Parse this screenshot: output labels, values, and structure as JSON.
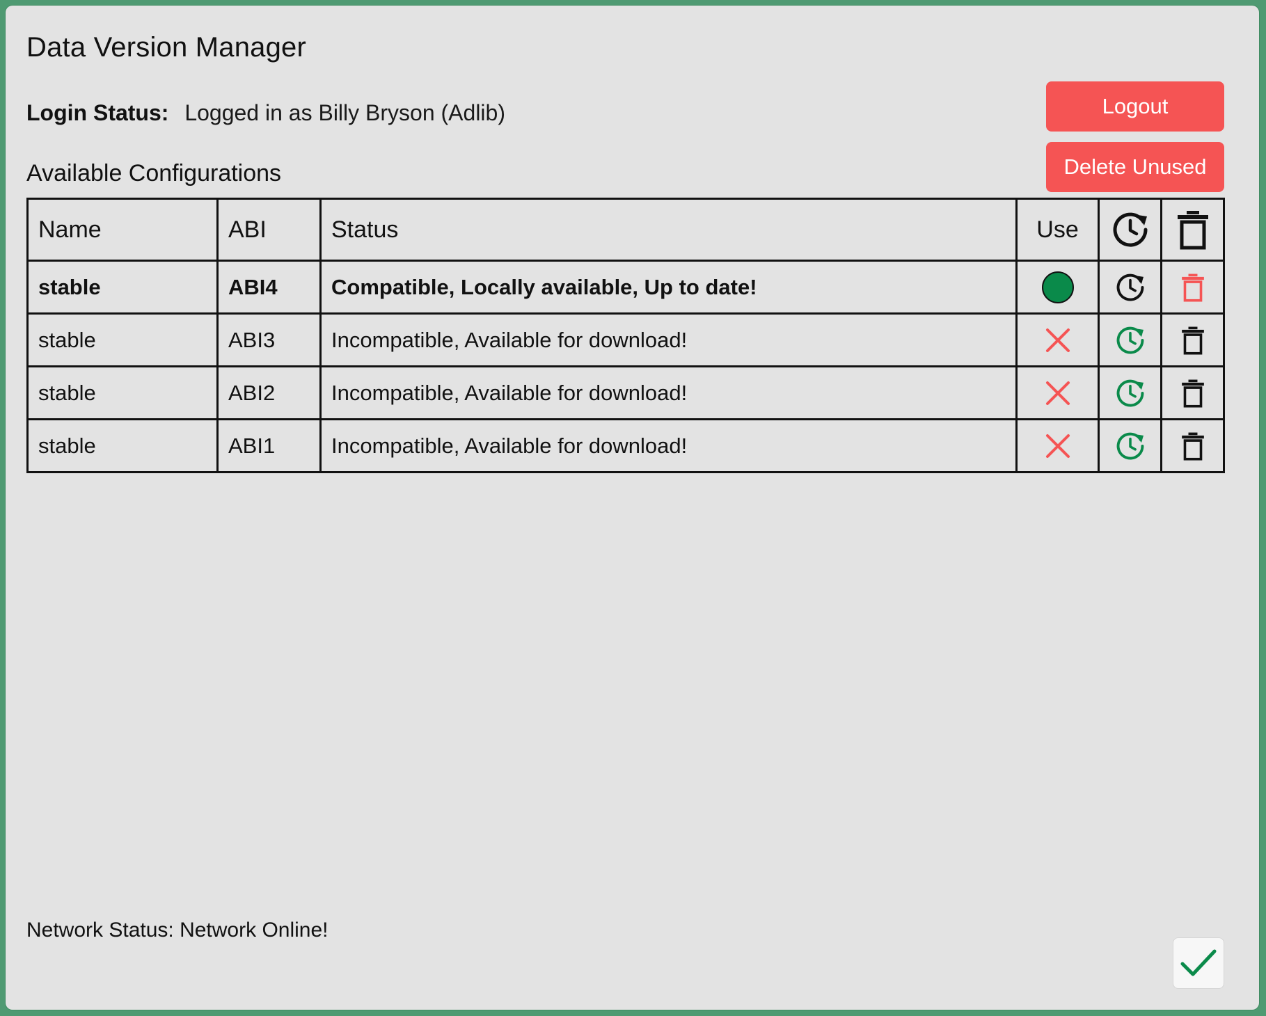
{
  "window": {
    "title": "Data Version Manager"
  },
  "login": {
    "label": "Login Status:",
    "value": "Logged in as Billy Bryson (Adlib)"
  },
  "buttons": {
    "logout": "Logout",
    "delete_unused": "Delete Unused"
  },
  "section_title": "Available Configurations",
  "table": {
    "headers": {
      "name": "Name",
      "abi": "ABI",
      "status": "Status",
      "use": "Use",
      "update_icon": "update-clock-icon",
      "delete_icon": "trash-icon"
    },
    "rows": [
      {
        "name": "stable",
        "abi": "ABI4",
        "status": "Compatible, Locally available, Up to date!",
        "use": "active-indicator",
        "update_color": "#111111",
        "delete_color": "#f55454",
        "active": true
      },
      {
        "name": "stable",
        "abi": "ABI3",
        "status": "Incompatible, Available for download!",
        "use": "incompatible-x",
        "update_color": "#0a8a4a",
        "delete_color": "#111111",
        "active": false
      },
      {
        "name": "stable",
        "abi": "ABI2",
        "status": "Incompatible, Available for download!",
        "use": "incompatible-x",
        "update_color": "#0a8a4a",
        "delete_color": "#111111",
        "active": false
      },
      {
        "name": "stable",
        "abi": "ABI1",
        "status": "Incompatible, Available for download!",
        "use": "incompatible-x",
        "update_color": "#0a8a4a",
        "delete_color": "#111111",
        "active": false
      }
    ]
  },
  "network": {
    "text": "Network Status: Network Online!"
  },
  "colors": {
    "accent_red": "#f55454",
    "accent_green": "#0a8a4a",
    "background": "#e3e3e3",
    "frame": "#4f9a72"
  },
  "confirm_icon": "checkmark-icon"
}
